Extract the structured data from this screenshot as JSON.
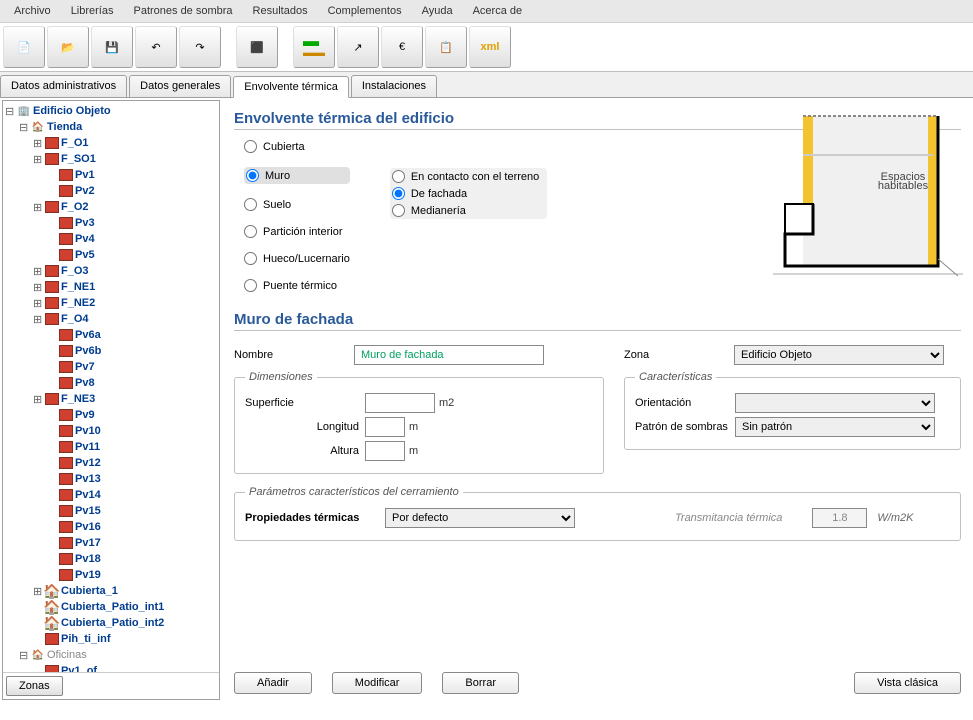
{
  "menu": [
    "Archivo",
    "Librerías",
    "Patrones de sombra",
    "Resultados",
    "Complementos",
    "Ayuda",
    "Acerca de"
  ],
  "tabs": [
    {
      "label": "Datos administrativos",
      "active": false
    },
    {
      "label": "Datos generales",
      "active": false
    },
    {
      "label": "Envolvente térmica",
      "active": true
    },
    {
      "label": "Instalaciones",
      "active": false
    }
  ],
  "tree_root": "Edificio Objeto",
  "tree": [
    {
      "indent": 1,
      "exp": "⊟",
      "icon": "🏠",
      "label": "Tienda",
      "cls": ""
    },
    {
      "indent": 2,
      "exp": "⊞",
      "icon": "",
      "label": "F_O1",
      "cls": "wall"
    },
    {
      "indent": 2,
      "exp": "⊞",
      "icon": "",
      "label": "F_SO1",
      "cls": "wall"
    },
    {
      "indent": 3,
      "exp": "",
      "icon": "",
      "label": "Pv1",
      "cls": "wall"
    },
    {
      "indent": 3,
      "exp": "",
      "icon": "",
      "label": "Pv2",
      "cls": "wall"
    },
    {
      "indent": 2,
      "exp": "⊞",
      "icon": "",
      "label": "F_O2",
      "cls": "wall"
    },
    {
      "indent": 3,
      "exp": "",
      "icon": "",
      "label": "Pv3",
      "cls": "wall"
    },
    {
      "indent": 3,
      "exp": "",
      "icon": "",
      "label": "Pv4",
      "cls": "wall"
    },
    {
      "indent": 3,
      "exp": "",
      "icon": "",
      "label": "Pv5",
      "cls": "wall"
    },
    {
      "indent": 2,
      "exp": "⊞",
      "icon": "",
      "label": "F_O3",
      "cls": "wall"
    },
    {
      "indent": 2,
      "exp": "⊞",
      "icon": "",
      "label": "F_NE1",
      "cls": "wall"
    },
    {
      "indent": 2,
      "exp": "⊞",
      "icon": "",
      "label": "F_NE2",
      "cls": "wall"
    },
    {
      "indent": 2,
      "exp": "⊞",
      "icon": "",
      "label": "F_O4",
      "cls": "wall"
    },
    {
      "indent": 3,
      "exp": "",
      "icon": "",
      "label": "Pv6a",
      "cls": "wall"
    },
    {
      "indent": 3,
      "exp": "",
      "icon": "",
      "label": "Pv6b",
      "cls": "wall"
    },
    {
      "indent": 3,
      "exp": "",
      "icon": "",
      "label": "Pv7",
      "cls": "wall"
    },
    {
      "indent": 3,
      "exp": "",
      "icon": "",
      "label": "Pv8",
      "cls": "wall"
    },
    {
      "indent": 2,
      "exp": "⊞",
      "icon": "",
      "label": "F_NE3",
      "cls": "wall"
    },
    {
      "indent": 3,
      "exp": "",
      "icon": "",
      "label": "Pv9",
      "cls": "wall"
    },
    {
      "indent": 3,
      "exp": "",
      "icon": "",
      "label": "Pv10",
      "cls": "wall"
    },
    {
      "indent": 3,
      "exp": "",
      "icon": "",
      "label": "Pv11",
      "cls": "wall"
    },
    {
      "indent": 3,
      "exp": "",
      "icon": "",
      "label": "Pv12",
      "cls": "wall"
    },
    {
      "indent": 3,
      "exp": "",
      "icon": "",
      "label": "Pv13",
      "cls": "wall"
    },
    {
      "indent": 3,
      "exp": "",
      "icon": "",
      "label": "Pv14",
      "cls": "wall"
    },
    {
      "indent": 3,
      "exp": "",
      "icon": "",
      "label": "Pv15",
      "cls": "wall"
    },
    {
      "indent": 3,
      "exp": "",
      "icon": "",
      "label": "Pv16",
      "cls": "wall"
    },
    {
      "indent": 3,
      "exp": "",
      "icon": "",
      "label": "Pv17",
      "cls": "wall"
    },
    {
      "indent": 3,
      "exp": "",
      "icon": "",
      "label": "Pv18",
      "cls": "wall"
    },
    {
      "indent": 3,
      "exp": "",
      "icon": "",
      "label": "Pv19",
      "cls": "wall"
    },
    {
      "indent": 2,
      "exp": "⊞",
      "icon": "🏠",
      "label": "Cubierta_1",
      "cls": "roof"
    },
    {
      "indent": 2,
      "exp": "",
      "icon": "🏠",
      "label": "Cubierta_Patio_int1",
      "cls": "roof"
    },
    {
      "indent": 2,
      "exp": "",
      "icon": "🏠",
      "label": "Cubierta_Patio_int2",
      "cls": "roof"
    },
    {
      "indent": 2,
      "exp": "",
      "icon": "",
      "label": "Pih_ti_inf",
      "cls": "wall"
    },
    {
      "indent": 1,
      "exp": "⊟",
      "icon": "🏠",
      "label": "Oficinas",
      "cls": "",
      "gray": true
    },
    {
      "indent": 2,
      "exp": "",
      "icon": "",
      "label": "Pv1_of",
      "cls": "wall"
    }
  ],
  "zones_btn": "Zonas",
  "section1_title": "Envolvente térmica del edificio",
  "radios_main": [
    "Cubierta",
    "Muro",
    "Suelo",
    "Partición interior",
    "Hueco/Lucernario",
    "Puente térmico"
  ],
  "radios_sub": [
    "En contacto con el terreno",
    "De fachada",
    "Medianería"
  ],
  "diagram_label": "Espacios habitables",
  "section2_title": "Muro de fachada",
  "labels": {
    "nombre": "Nombre",
    "nombre_val": "Muro de fachada",
    "zona": "Zona",
    "zona_val": "Edificio Objeto",
    "dimensiones": "Dimensiones",
    "caracteristicas": "Características",
    "superficie": "Superficie",
    "m2": "m2",
    "longitud": "Longitud",
    "altura": "Altura",
    "m": "m",
    "orientacion": "Orientación",
    "patron": "Patrón de sombras",
    "patron_val": "Sin patrón",
    "params": "Parámetros característicos del cerramiento",
    "prop": "Propiedades térmicas",
    "prop_val": "Por defecto",
    "trans": "Transmitancia térmica",
    "trans_val": "1.8",
    "trans_unit": "W/m2K"
  },
  "buttons": {
    "anadir": "Añadir",
    "modificar": "Modificar",
    "borrar": "Borrar",
    "vista": "Vista clásica"
  }
}
